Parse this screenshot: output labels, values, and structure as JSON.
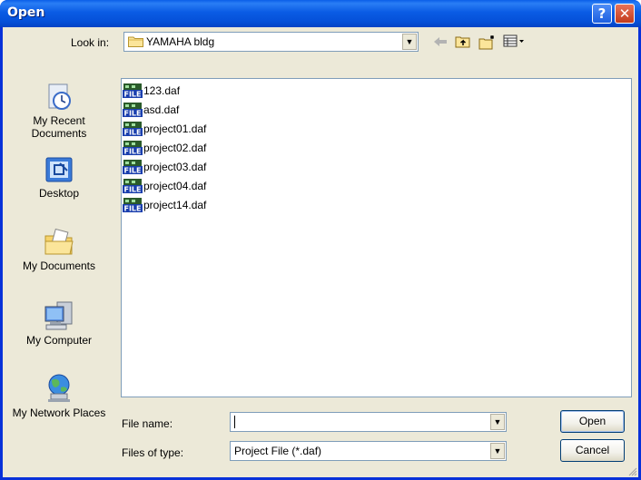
{
  "window": {
    "title": "Open",
    "help_glyph": "?",
    "close_glyph": "✕"
  },
  "toolbar": {
    "look_in_label": "Look in:",
    "look_in_value": "YAMAHA bldg",
    "back_icon": "back-arrow-icon",
    "up_icon": "up-folder-icon",
    "new_folder_icon": "new-folder-icon",
    "views_icon": "views-menu-icon"
  },
  "places": [
    {
      "label": "My Recent Documents",
      "icon": "recent-documents-icon"
    },
    {
      "label": "Desktop",
      "icon": "desktop-icon"
    },
    {
      "label": "My Documents",
      "icon": "my-documents-icon"
    },
    {
      "label": "My Computer",
      "icon": "my-computer-icon"
    },
    {
      "label": "My Network Places",
      "icon": "network-places-icon"
    }
  ],
  "files": [
    {
      "name": "123.daf"
    },
    {
      "name": "asd.daf"
    },
    {
      "name": "project01.daf"
    },
    {
      "name": "project02.daf"
    },
    {
      "name": "project03.daf"
    },
    {
      "name": "project04.daf"
    },
    {
      "name": "project14.daf"
    }
  ],
  "file_icon_text": "FILE",
  "form": {
    "file_name_label": "File name:",
    "file_name_value": "",
    "file_type_label": "Files of type:",
    "file_type_value": "Project File (*.daf)"
  },
  "buttons": {
    "open": "Open",
    "cancel": "Cancel"
  },
  "colors": {
    "title_bar": "#0a5be4",
    "window_bg": "#ece9d8",
    "border_blue": "#7f9db9",
    "close_red": "#c23b1c"
  }
}
